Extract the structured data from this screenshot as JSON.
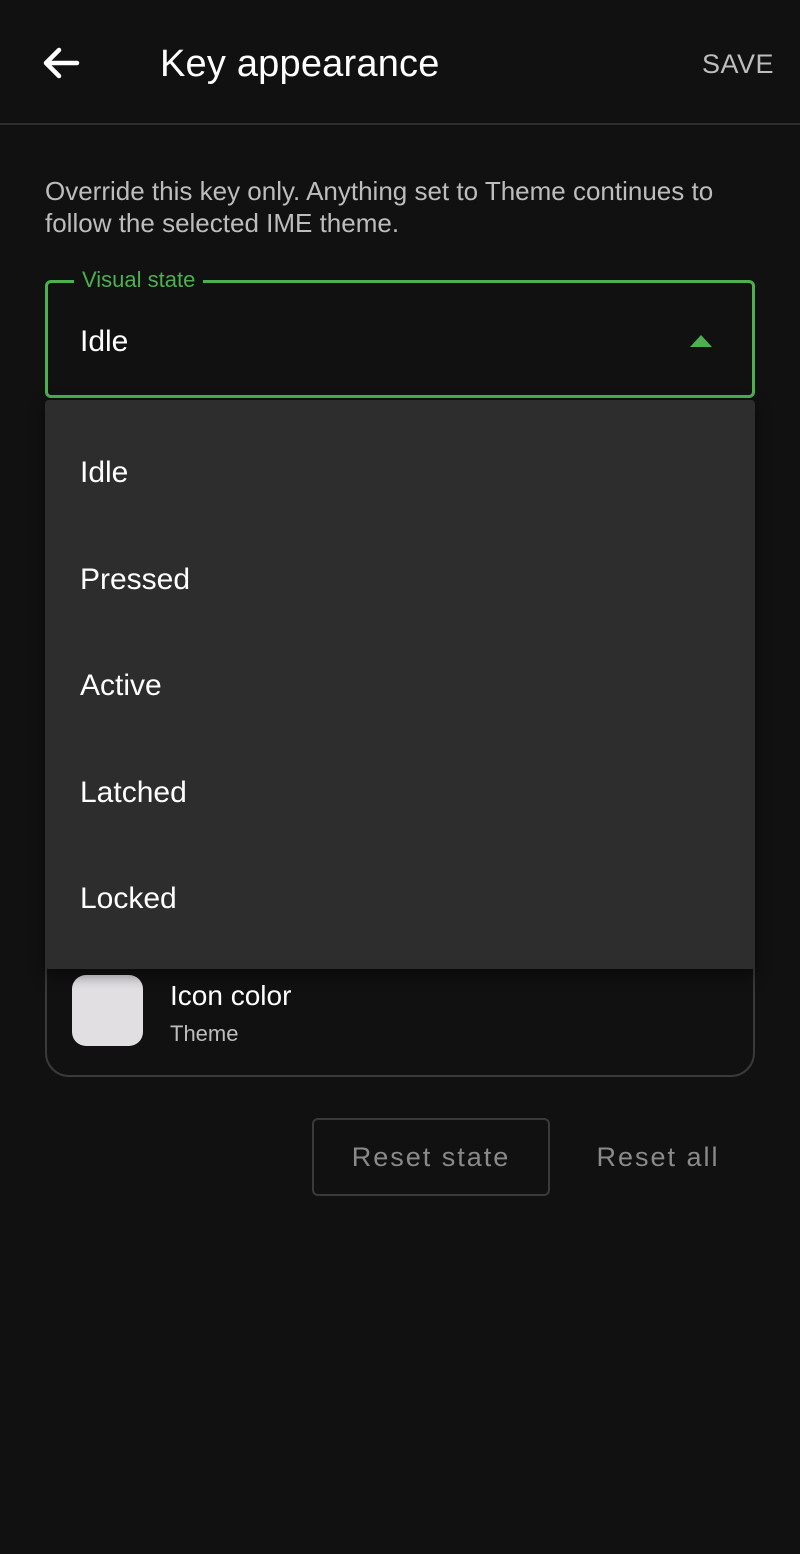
{
  "header": {
    "title": "Key appearance",
    "save_label": "SAVE",
    "back_icon": "arrow-left-icon"
  },
  "description": "Override this key only. Anything set to Theme continues to follow the selected IME theme.",
  "visual_state": {
    "label": "Visual state",
    "selected": "Idle",
    "arrow_icon": "caret-up-icon",
    "options": [
      "Idle",
      "Pressed",
      "Active",
      "Latched",
      "Locked"
    ]
  },
  "icon_color": {
    "title": "Icon color",
    "subtitle": "Theme",
    "swatch_color": "#e2dfe3"
  },
  "actions": {
    "reset_state": "Reset state",
    "reset_all": "Reset all"
  },
  "colors": {
    "accent": "#4caf50",
    "background": "#111111",
    "menu_background": "#2d2d2d"
  }
}
